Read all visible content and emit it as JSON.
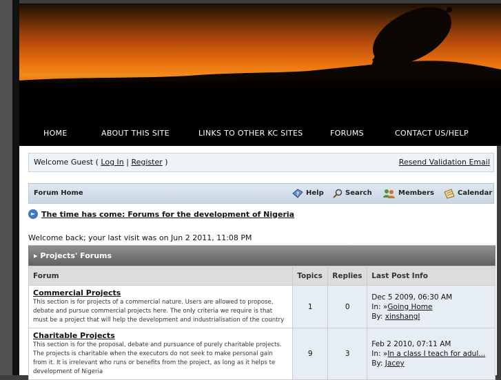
{
  "nav": {
    "items": [
      "HOME",
      "ABOUT THIS SITE",
      "LINKS TO OTHER KC SITES",
      "FORUMS",
      "CONTACT US/HELP"
    ]
  },
  "welcome": {
    "prefix": "Welcome Guest ( ",
    "login": "Log In",
    "sep": " | ",
    "register": "Register",
    "suffix": " )",
    "resend": "Resend Validation Email"
  },
  "forumbar": {
    "home": "Forum Home",
    "help": "Help",
    "search": "Search",
    "members": "Members",
    "calendar": "Calendar"
  },
  "news": {
    "title": "The time has come: Forums for the development of Nigeria"
  },
  "last_visit": "Welcome back; your last visit was on Jun 2 2011, 11:08 PM",
  "category": {
    "title": "Projects' Forums"
  },
  "table": {
    "headers": [
      "Forum",
      "Topics",
      "Replies",
      "Last Post Info"
    ],
    "rows": [
      {
        "title": "Commercial Projects",
        "desc": "This section is for projects of a commercial nature. Users are allowed to propose, debate and pursue commercial projects here. The only criteria we require is that must be a project that will help the development and industrialisation of the country",
        "topics": "1",
        "replies": "0",
        "last_date": "Dec 5 2009, 06:30 AM",
        "in_label": "In:",
        "in_topic": "Going Home",
        "by_label": "By:",
        "by_user": "xinshangl"
      },
      {
        "title": "Charitable Projects",
        "desc": "This section is for the proposal, debate and pursuance of purely charitable projects. The projects is charitable when the executors do not seek to make personal gain from it. It is irrelevant who runs or benefits from the project, as long as it helps te development of Nigeria",
        "topics": "9",
        "replies": "3",
        "last_date": "Feb 2 2010, 07:11 AM",
        "in_label": "In:",
        "in_topic": "In a class I teach for adul...",
        "by_label": "By:",
        "by_user": "Jacey"
      }
    ]
  },
  "colors": {
    "page_bg": "#3d3d3d",
    "nav_bg": "#000000",
    "cell_bg": "#e6edf4",
    "category_bar": "#6e6e6e"
  }
}
